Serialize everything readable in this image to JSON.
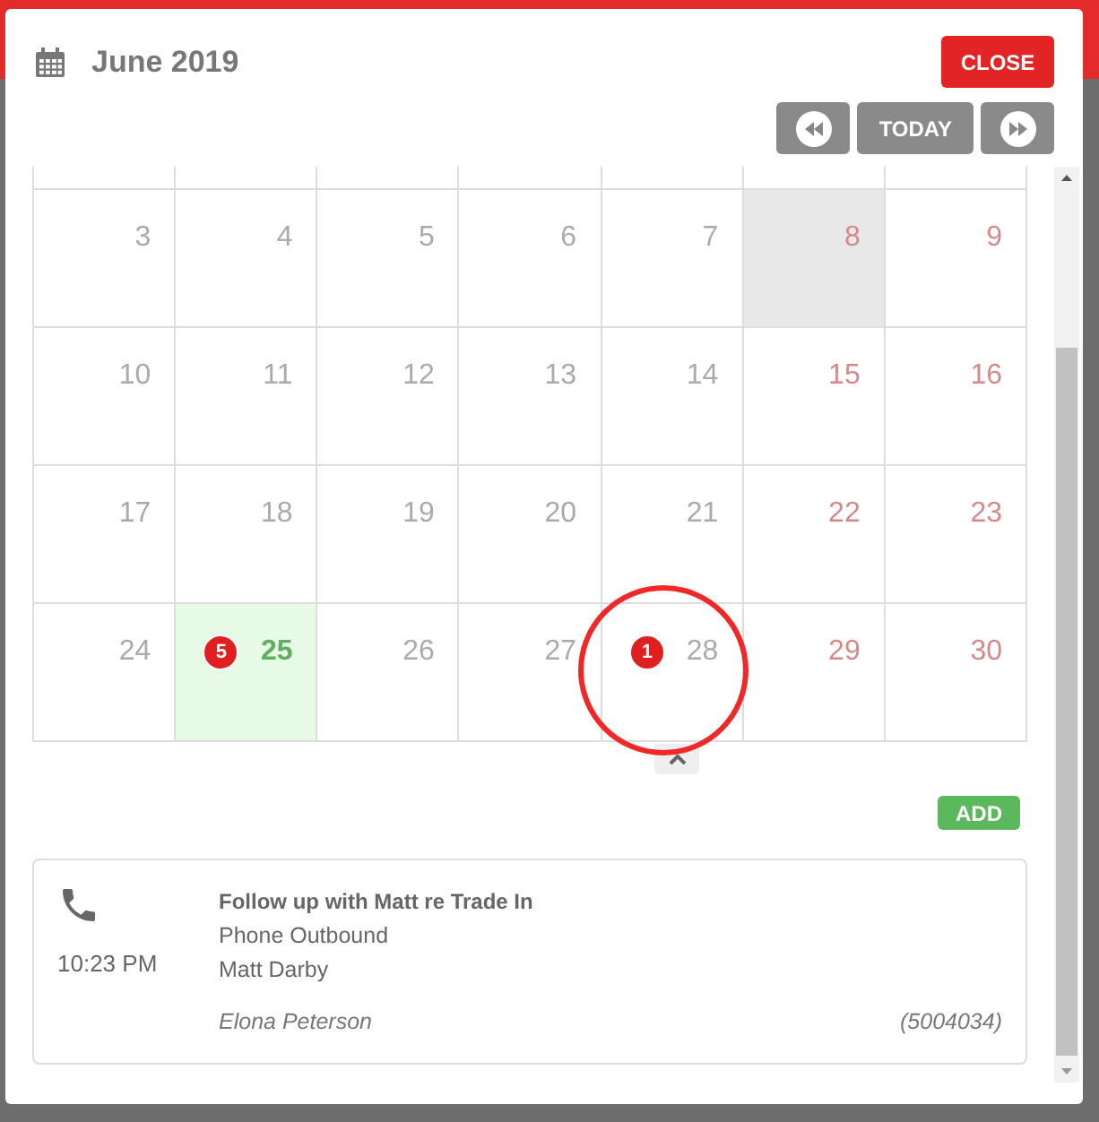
{
  "header": {
    "title": "June 2019",
    "close": "CLOSE"
  },
  "nav": {
    "today": "TODAY"
  },
  "weeks": [
    {
      "days": [
        {
          "day": "3",
          "weekend": false,
          "shaded": false,
          "selected": false
        },
        {
          "day": "4",
          "weekend": false,
          "shaded": false,
          "selected": false
        },
        {
          "day": "5",
          "weekend": false,
          "shaded": false,
          "selected": false
        },
        {
          "day": "6",
          "weekend": false,
          "shaded": false,
          "selected": false
        },
        {
          "day": "7",
          "weekend": false,
          "shaded": false,
          "selected": false
        },
        {
          "day": "8",
          "weekend": true,
          "shaded": true,
          "selected": false
        },
        {
          "day": "9",
          "weekend": true,
          "shaded": false,
          "selected": false
        }
      ]
    },
    {
      "days": [
        {
          "day": "10",
          "weekend": false,
          "shaded": false,
          "selected": false
        },
        {
          "day": "11",
          "weekend": false,
          "shaded": false,
          "selected": false
        },
        {
          "day": "12",
          "weekend": false,
          "shaded": false,
          "selected": false
        },
        {
          "day": "13",
          "weekend": false,
          "shaded": false,
          "selected": false
        },
        {
          "day": "14",
          "weekend": false,
          "shaded": false,
          "selected": false
        },
        {
          "day": "15",
          "weekend": true,
          "shaded": false,
          "selected": false
        },
        {
          "day": "16",
          "weekend": true,
          "shaded": false,
          "selected": false
        }
      ]
    },
    {
      "days": [
        {
          "day": "17",
          "weekend": false,
          "shaded": false,
          "selected": false
        },
        {
          "day": "18",
          "weekend": false,
          "shaded": false,
          "selected": false
        },
        {
          "day": "19",
          "weekend": false,
          "shaded": false,
          "selected": false
        },
        {
          "day": "20",
          "weekend": false,
          "shaded": false,
          "selected": false
        },
        {
          "day": "21",
          "weekend": false,
          "shaded": false,
          "selected": false
        },
        {
          "day": "22",
          "weekend": true,
          "shaded": false,
          "selected": false
        },
        {
          "day": "23",
          "weekend": true,
          "shaded": false,
          "selected": false
        }
      ]
    },
    {
      "days": [
        {
          "day": "24",
          "weekend": false,
          "shaded": false,
          "selected": false
        },
        {
          "day": "25",
          "weekend": false,
          "shaded": false,
          "selected": true,
          "count": "5"
        },
        {
          "day": "26",
          "weekend": false,
          "shaded": false,
          "selected": false
        },
        {
          "day": "27",
          "weekend": false,
          "shaded": false,
          "selected": false
        },
        {
          "day": "28",
          "weekend": false,
          "shaded": false,
          "selected": false,
          "count": "1",
          "circled": true
        },
        {
          "day": "29",
          "weekend": true,
          "shaded": false,
          "selected": false
        },
        {
          "day": "30",
          "weekend": true,
          "shaded": false,
          "selected": false
        }
      ]
    }
  ],
  "add": "ADD",
  "events": [
    {
      "time": "10:23 PM",
      "title": "Follow up with Matt re Trade In",
      "type": "Phone Outbound",
      "contact": "Matt Darby",
      "owner": "Elona Peterson",
      "ref": "(5004034)"
    }
  ]
}
